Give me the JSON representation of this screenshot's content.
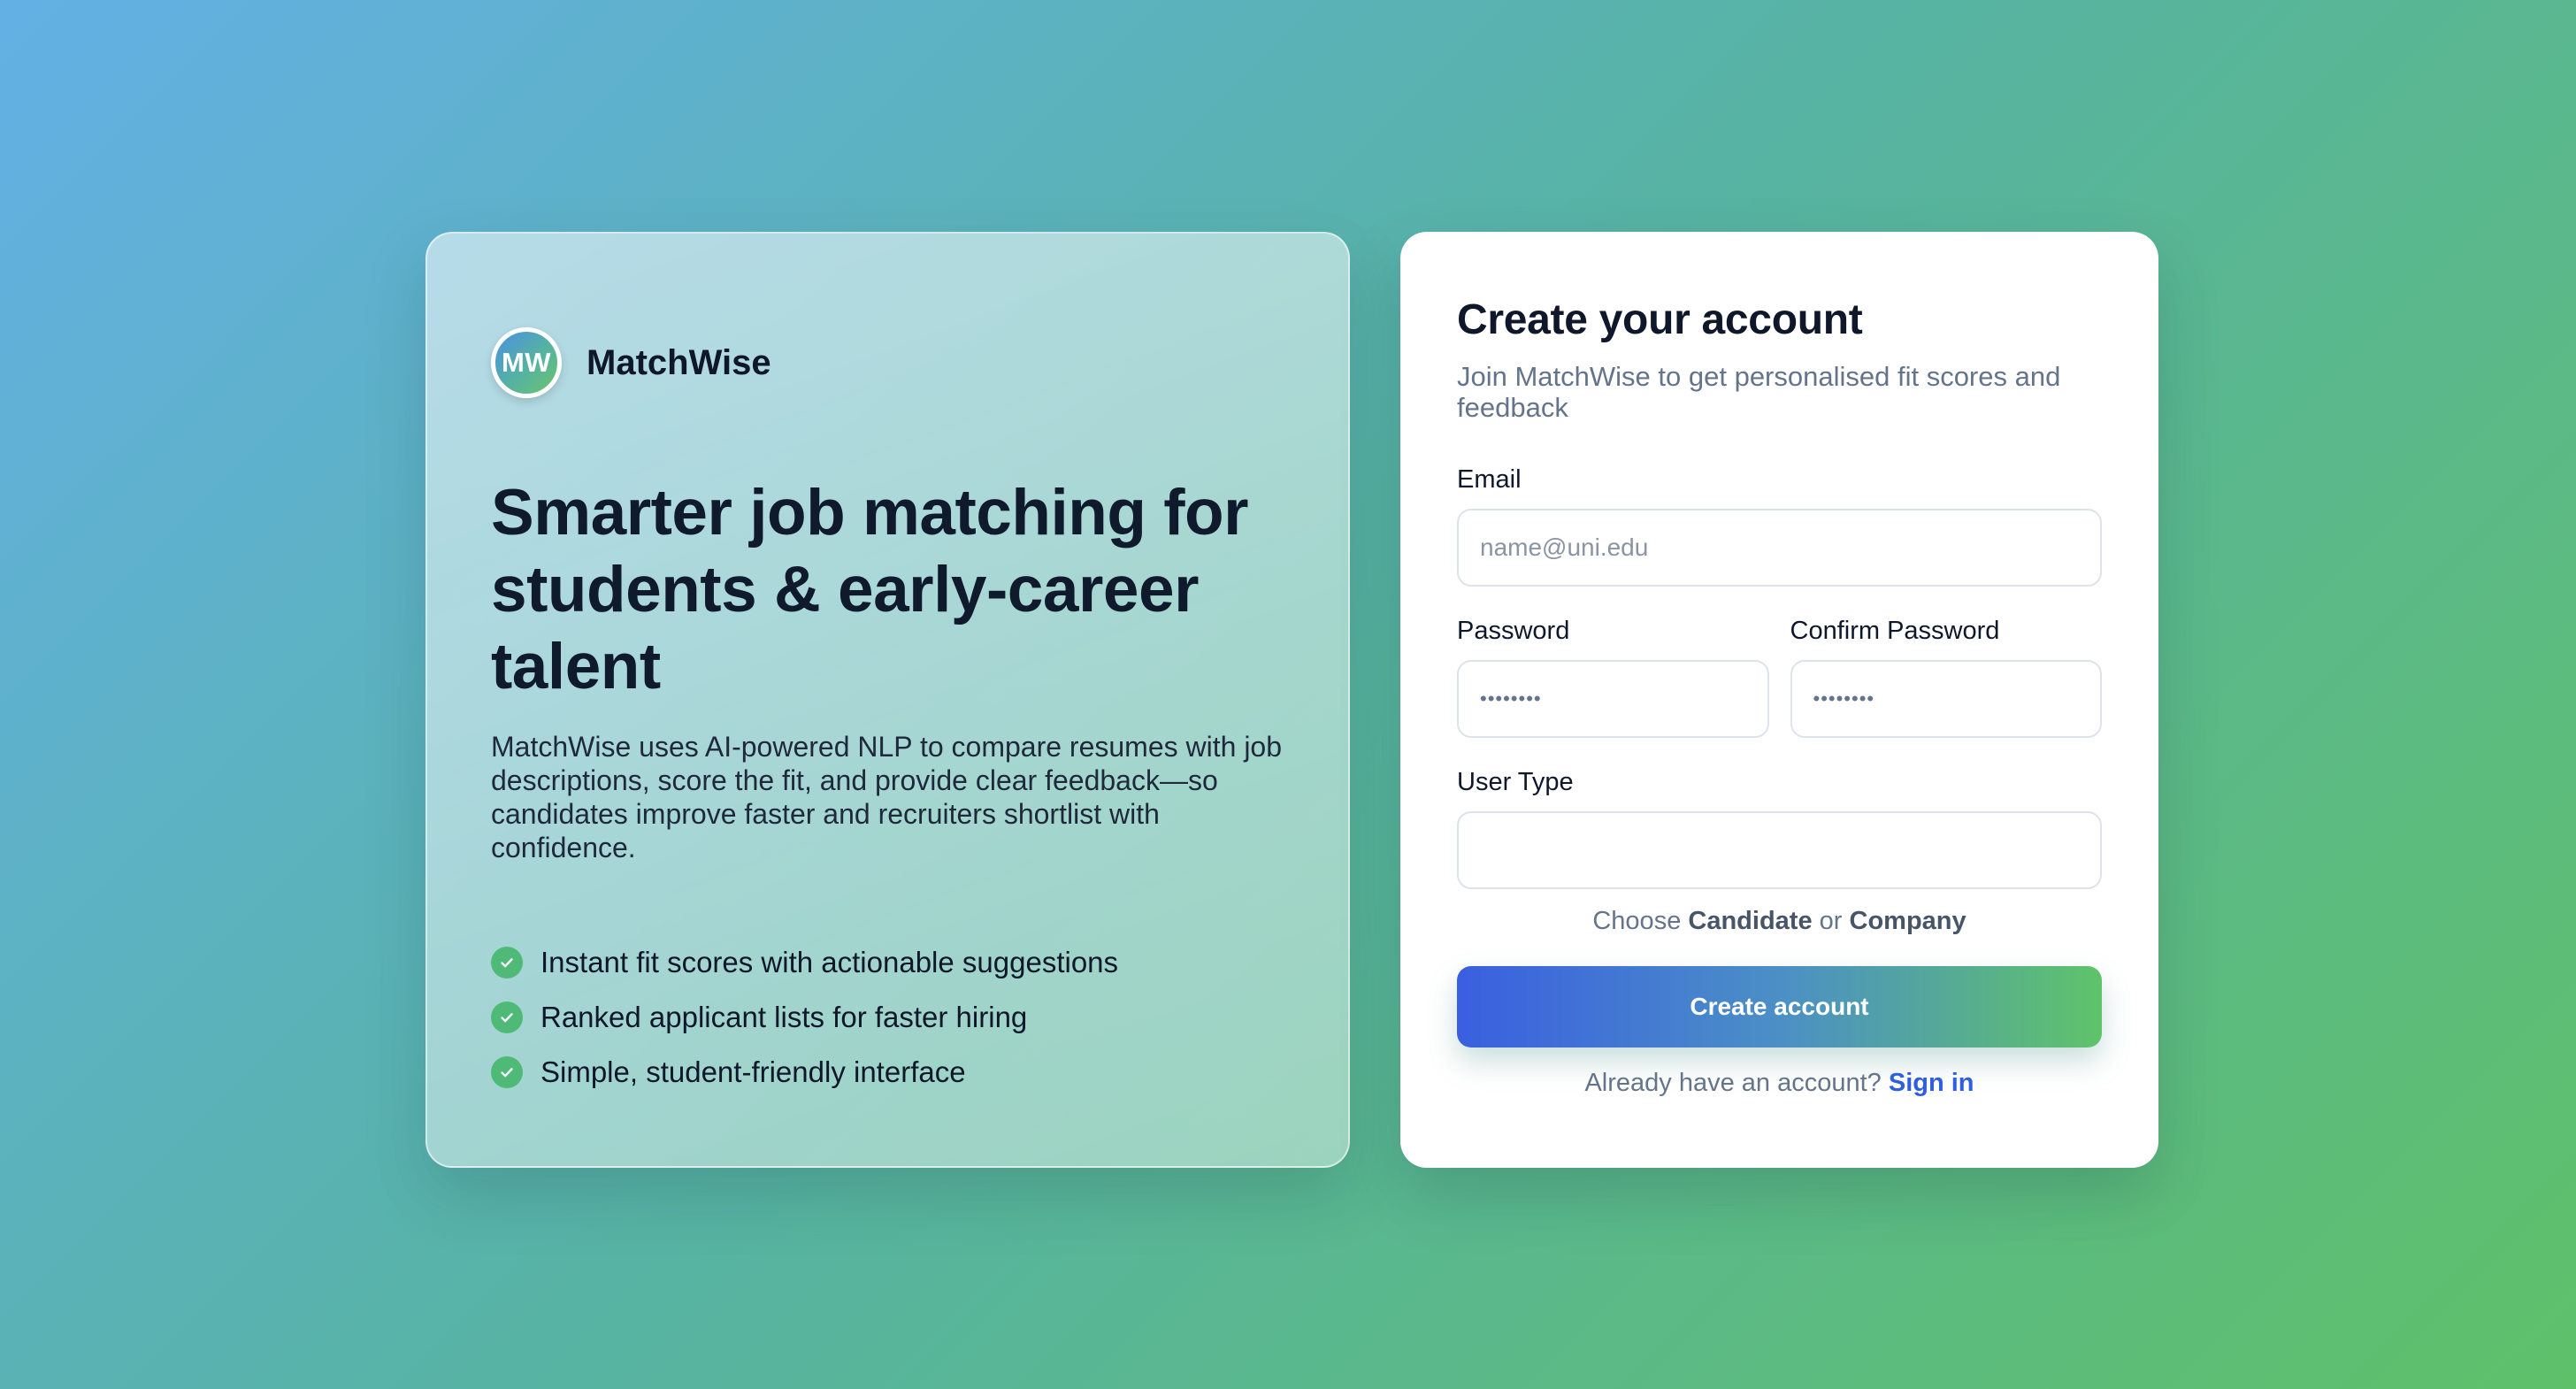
{
  "brand": {
    "logo_text": "MW",
    "name": "MatchWise"
  },
  "hero": {
    "title_lines": [
      "Smarter job matching for",
      "students & early-career",
      "talent"
    ],
    "description": "MatchWise uses AI-powered NLP to compare resumes with job descriptions, score the fit, and provide clear feedback—so candidates improve faster and recruiters shortlist with confidence.",
    "features": [
      "Instant fit scores with actionable suggestions",
      "Ranked applicant lists for faster hiring",
      "Simple, student-friendly interface"
    ],
    "check_icon": "check-circle-icon"
  },
  "form": {
    "title": "Create your account",
    "subtitle": "Join MatchWise to get personalised fit scores and feedback",
    "email": {
      "label": "Email",
      "placeholder": "name@uni.edu",
      "value": ""
    },
    "password": {
      "label": "Password",
      "placeholder": "••••••••"
    },
    "confirm_password": {
      "label": "Confirm Password",
      "placeholder": "••••••••"
    },
    "user_type": {
      "label": "User Type",
      "value": ""
    },
    "hint": {
      "prefix": "Choose",
      "option_a": "Candidate",
      "connector": "or",
      "option_b": "Company"
    },
    "submit_label": "Create account",
    "signin": {
      "prompt": "Already have an account?",
      "link_label": "Sign in"
    }
  },
  "colors": {
    "accent_blue": "#2f5fe0",
    "accent_green": "#5fc36a",
    "check_green": "#4fb978"
  }
}
